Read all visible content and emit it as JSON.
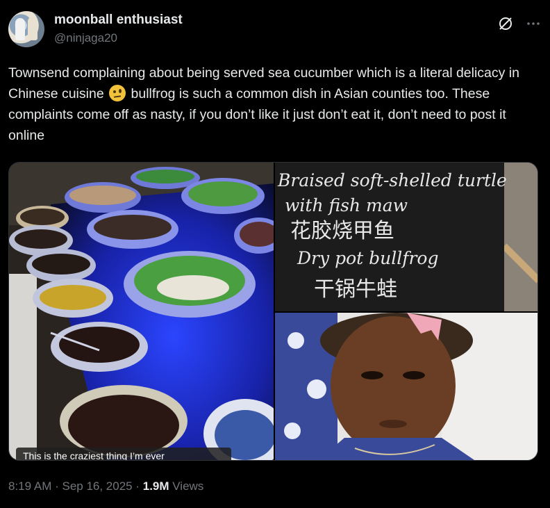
{
  "author": {
    "display_name": "moonball enthusiast",
    "handle": "@ninjaga20"
  },
  "icons": {
    "grok": "grok-icon",
    "more": "more-icon"
  },
  "tweet": {
    "text_part1": "Townsend complaining about being served sea cucumber which is a literal delicacy in Chinese cuisine ",
    "text_part2": " bullfrog is such a common dish in Asian counties too. These complaints come off as nasty, if you don’t like it just don’t eat it, don’t need to post it online"
  },
  "media": {
    "caption": "This is the craziest thing I’m ever",
    "sign_lines": [
      "Braised soft-shelled turtle",
      "with fish maw",
      "花胶烧甲鱼",
      "Dry pot bullfrog",
      "干锅牛蛙"
    ]
  },
  "meta": {
    "time": "8:19 AM",
    "sep1": " · ",
    "date": "Sep 16, 2025",
    "sep2": " · ",
    "views_count": "1.9M",
    "views_label": " Views"
  }
}
